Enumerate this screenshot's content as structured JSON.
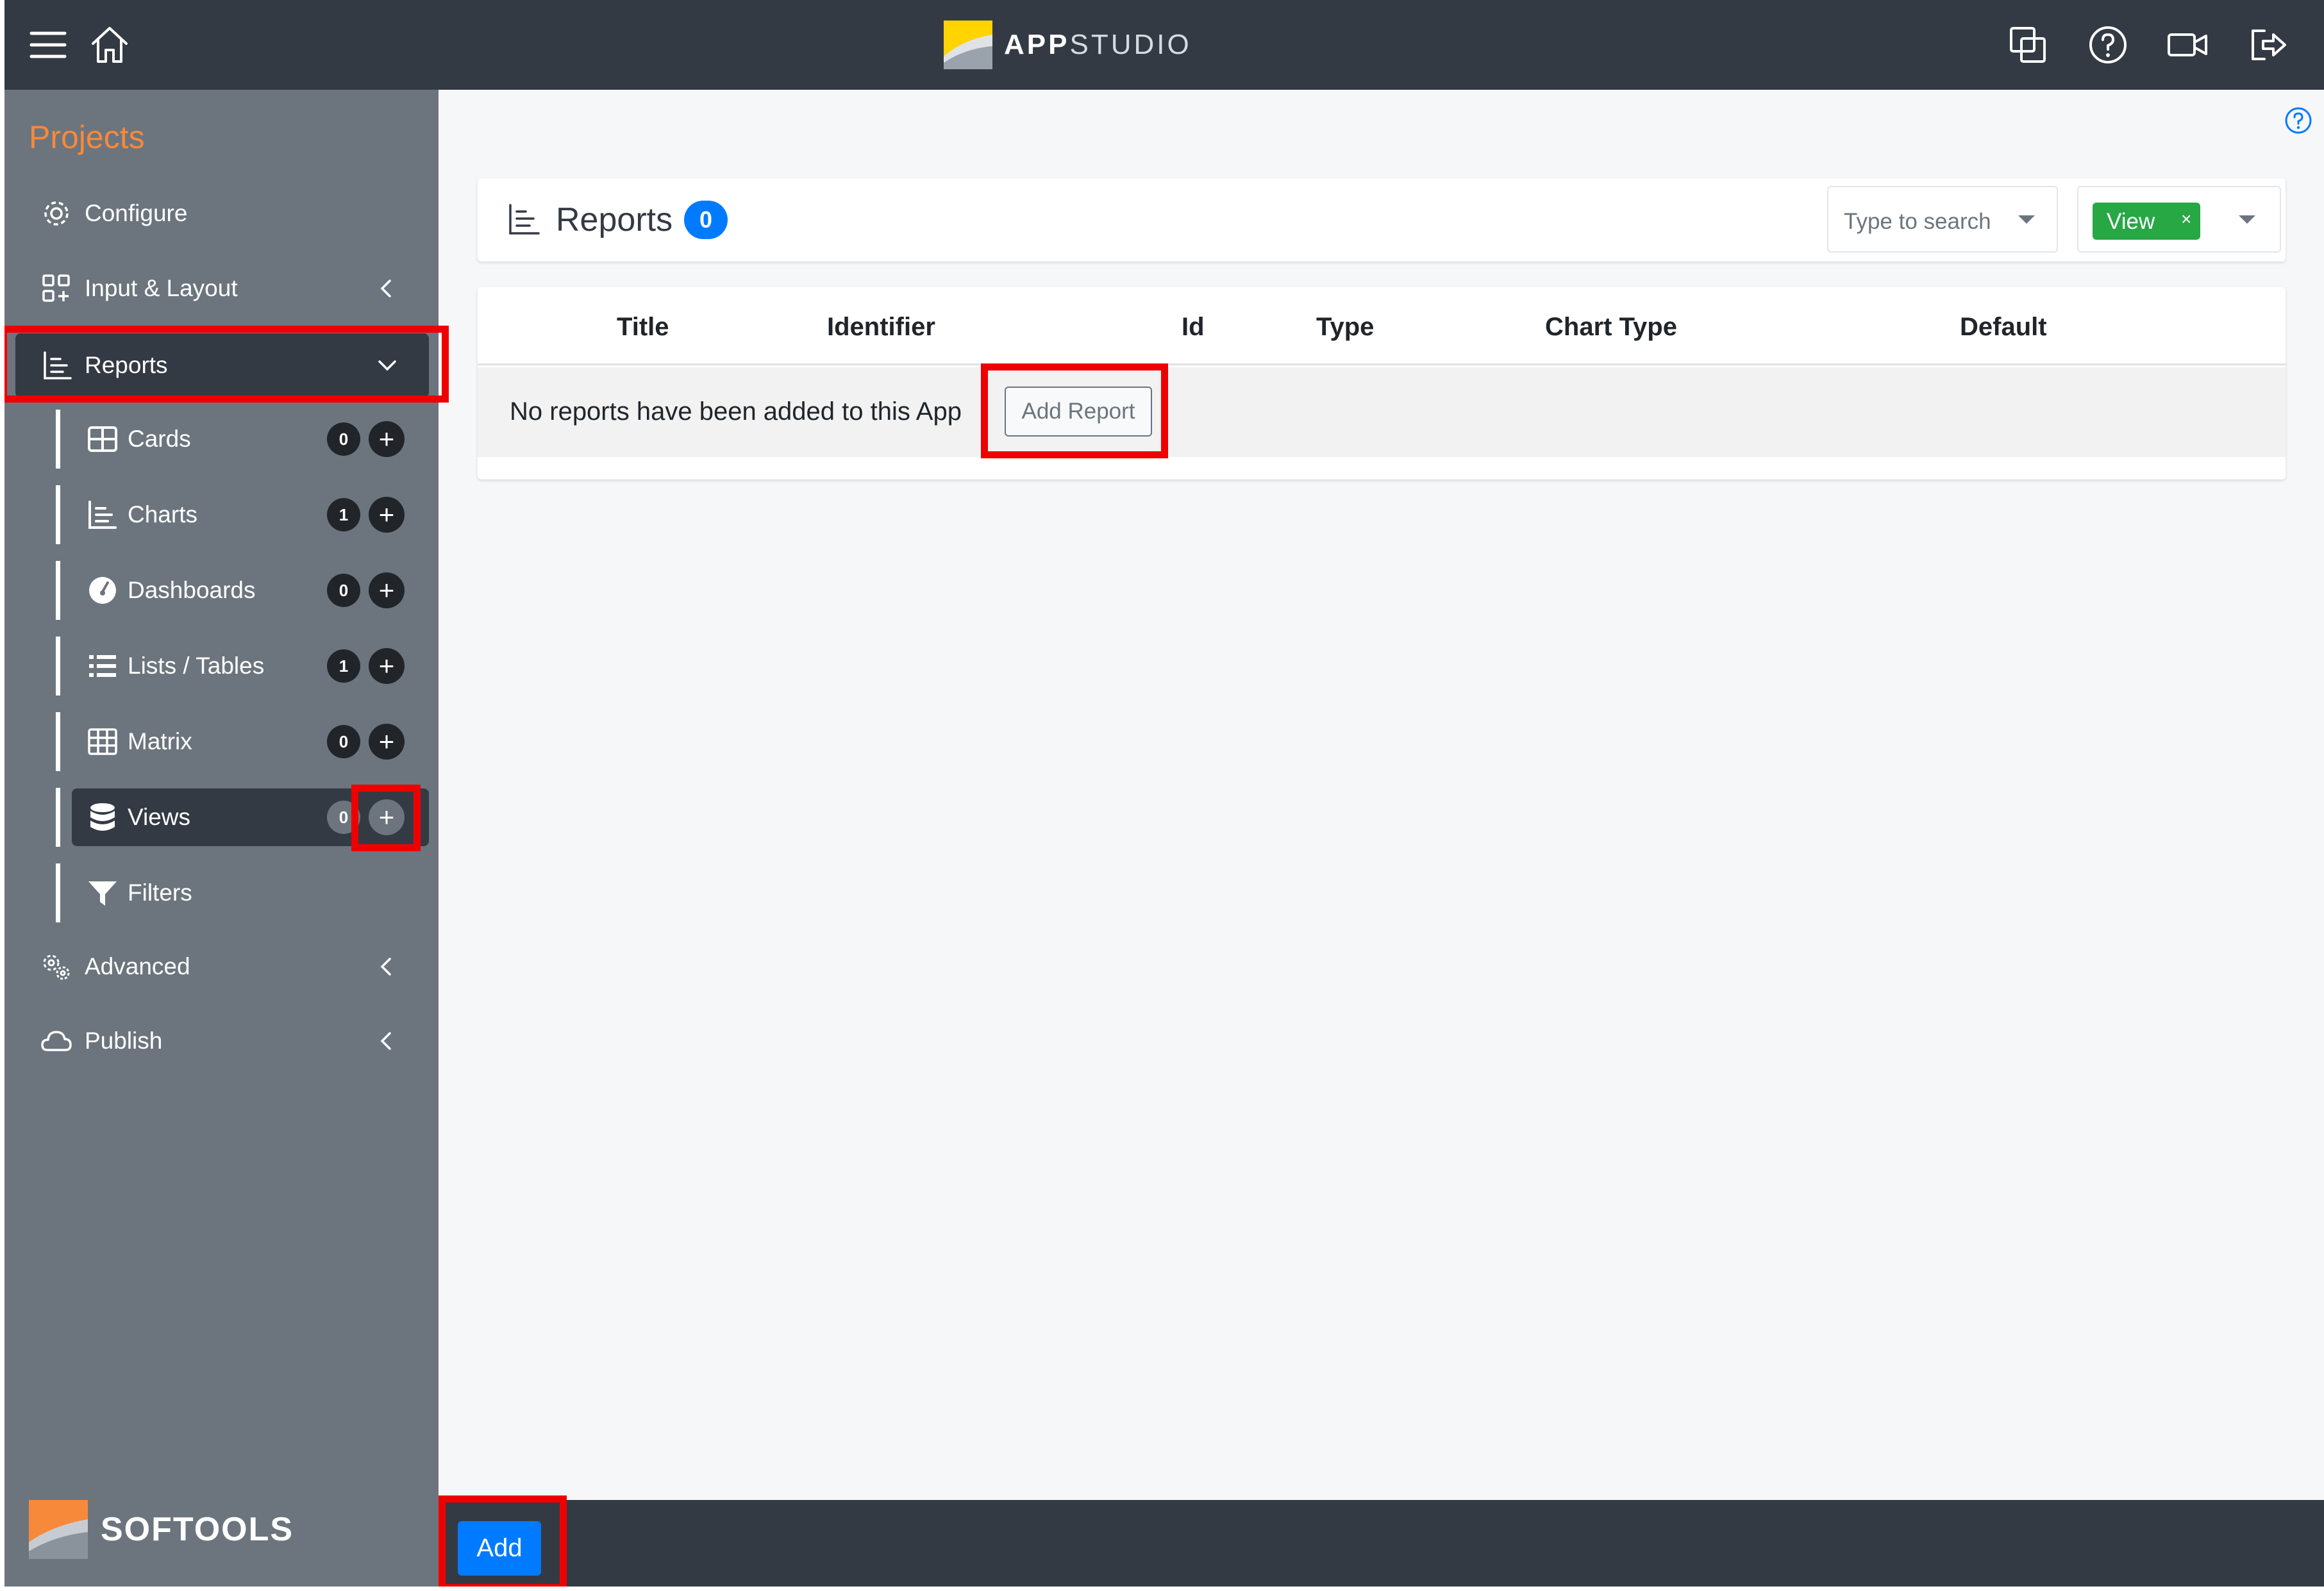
{
  "app": {
    "brand_bold": "APP",
    "brand_light": "STUDIO"
  },
  "topbar": {
    "menu_icon": "hamburger-menu-icon",
    "home_icon": "home-icon",
    "right_icons": [
      "copy-windows-icon",
      "help-circle-icon",
      "video-camera-icon",
      "logout-icon"
    ]
  },
  "sidebar": {
    "title": "Projects",
    "nav": [
      {
        "label": "Configure",
        "icon": "gear-icon"
      },
      {
        "label": "Input & Layout",
        "icon": "layout-grid-icon"
      },
      {
        "label": "Reports",
        "icon": "bar-chart-icon"
      },
      {
        "label": "Advanced",
        "icon": "gears-icon"
      },
      {
        "label": "Publish",
        "icon": "cloud-icon"
      }
    ],
    "sub": [
      {
        "label": "Cards",
        "count": "0",
        "icon": "cards-grid-icon"
      },
      {
        "label": "Charts",
        "count": "1",
        "icon": "chart-icon"
      },
      {
        "label": "Dashboards",
        "count": "0",
        "icon": "gauge-icon"
      },
      {
        "label": "Lists / Tables",
        "count": "1",
        "icon": "list-icon"
      },
      {
        "label": "Matrix",
        "count": "0",
        "icon": "matrix-grid-icon"
      },
      {
        "label": "Views",
        "count": "0",
        "icon": "database-icon"
      },
      {
        "label": "Filters",
        "icon": "filter-icon"
      }
    ],
    "plus": "+",
    "footer_brand": "SOFTOOLS"
  },
  "main": {
    "header_title": "Reports",
    "header_count": "0",
    "search_placeholder": "Type to search",
    "view_tag": "View",
    "view_tag_close": "×",
    "columns": [
      "Title",
      "Identifier",
      "Id",
      "Type",
      "Chart Type",
      "Default"
    ],
    "empty_message": "No reports have been added to this App",
    "add_report_label": "Add Report"
  },
  "bottombar": {
    "add_label": "Add"
  },
  "colors": {
    "topbar": "#343a43",
    "sidebar": "#6c757d",
    "accent_orange": "#f7893b",
    "primary_blue": "#007bff",
    "tag_green": "#28a745",
    "highlight_red": "#ee0000",
    "brand_yellow": "#ffd400"
  }
}
